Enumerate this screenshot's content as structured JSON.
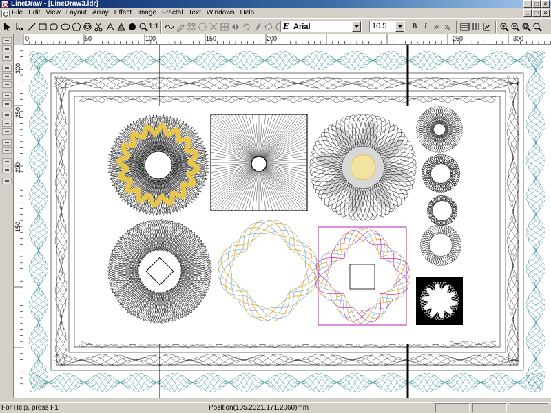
{
  "window": {
    "title": "LineDraw - [LineDraw3.ldr]",
    "min_label": "_",
    "max_label": "□",
    "close_label": "×"
  },
  "menu": {
    "items": [
      "File",
      "Edit",
      "View",
      "Layout",
      "Array",
      "Effect",
      "Image",
      "Fractal",
      "Text",
      "Windows",
      "Help"
    ]
  },
  "toolbar": {
    "one_to_one_label": "1:1",
    "font_name": "Arial",
    "font_icon": "E",
    "font_size": "10.5",
    "bold_label": "B",
    "italic_label": "I",
    "superscript_label": "x²",
    "subscript_label": "x₂",
    "icons": [
      "pointer-icon",
      "node-select-icon",
      "line-icon",
      "rectangle-icon",
      "rounded-rectangle-icon",
      "ellipse-icon",
      "polygon-icon",
      "spiral-icon",
      "scissors-icon",
      "text-warp-icon",
      "text-icon",
      "fill-icon",
      "zoom-icon",
      "wave-icon",
      "pen-icon",
      "array-icon",
      "effect-icon",
      "fractal-icon",
      "brush-icon",
      "eraser-icon",
      "circle-icon"
    ]
  },
  "rulers": {
    "horizontal_labels": [
      "0",
      "50",
      "100",
      "150",
      "200",
      "250",
      "300"
    ],
    "vertical_labels": [
      "300",
      "250",
      "200",
      "150"
    ]
  },
  "canvas": {
    "colors": {
      "teal": "#2e8a9a",
      "black": "#111111",
      "yellow": "#e8c64a",
      "light_yellow": "#f2e3a0",
      "magenta": "#c020b0",
      "orange": "#e0a020",
      "light_blue": "#7ab0d0"
    }
  },
  "status": {
    "help_text": "For Help, press F1",
    "position_text": "Position(105.2321,171.2060)mm"
  }
}
